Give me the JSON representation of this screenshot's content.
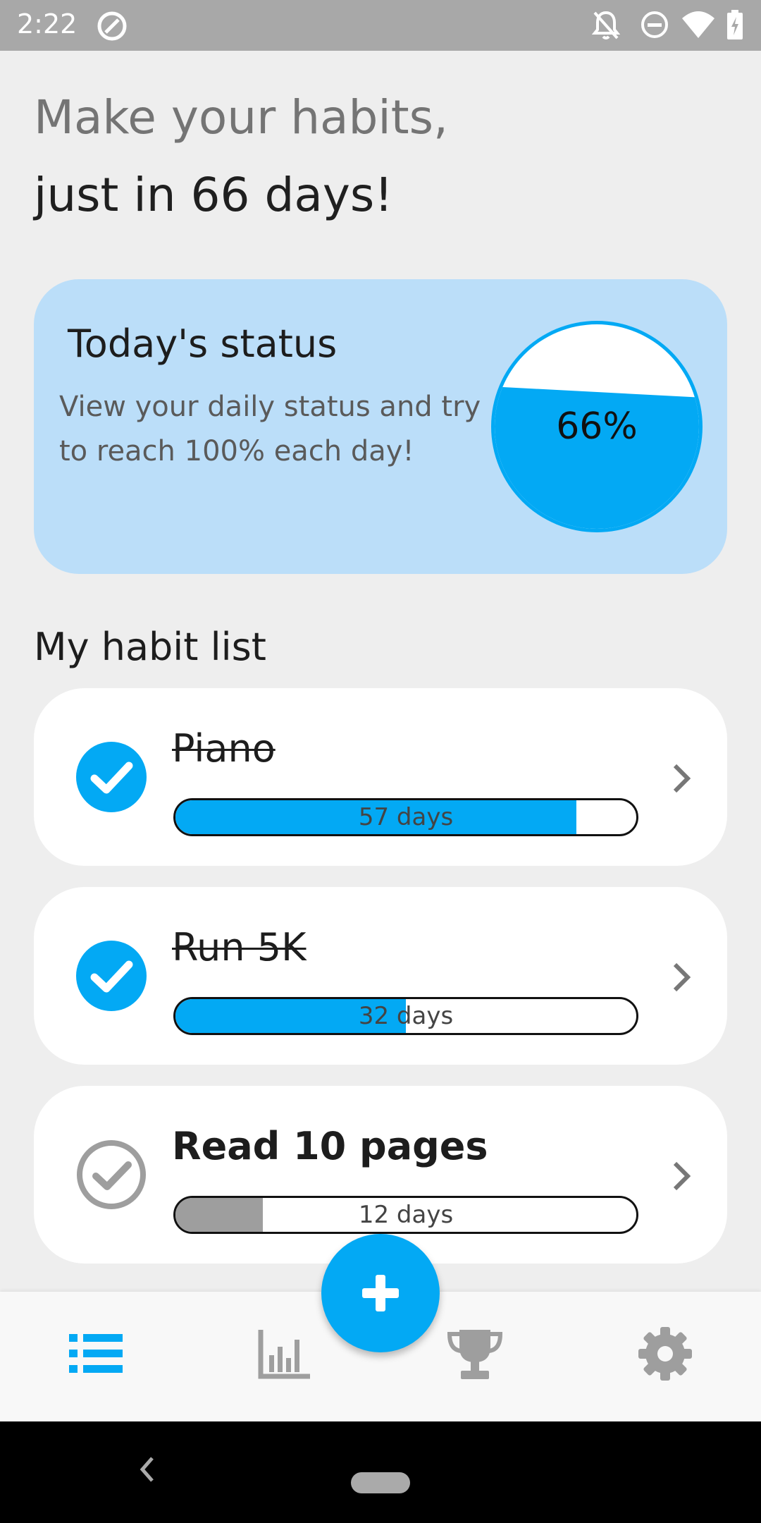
{
  "status_bar": {
    "time": "2:22",
    "icons": [
      "at-sign-icon",
      "notifications-off-icon",
      "do-not-disturb-icon",
      "wifi-icon",
      "battery-charging-icon"
    ]
  },
  "header": {
    "line1": "Make your habits,",
    "line2": "just in 66 days!"
  },
  "status_card": {
    "title": "Today's status",
    "description": "View your daily status and try to reach 100% each day!",
    "percent_label": "66%",
    "percent_value": 66
  },
  "habit_list": {
    "title": "My habit list",
    "items": [
      {
        "name": "Piano",
        "completed": true,
        "days_label": "57 days",
        "progress": 0.87,
        "fill_color": "#03a9f4"
      },
      {
        "name": "Run 5K",
        "completed": true,
        "days_label": "32 days",
        "progress": 0.5,
        "fill_color": "#03a9f4"
      },
      {
        "name": "Read 10 pages",
        "completed": false,
        "days_label": "12 days",
        "progress": 0.19,
        "fill_color": "#9e9e9e"
      }
    ]
  },
  "fab": {
    "icon": "plus-icon"
  },
  "bottom_nav": {
    "items": [
      {
        "icon": "list-icon",
        "active": true
      },
      {
        "icon": "bar-chart-icon",
        "active": false
      },
      {
        "icon": "trophy-icon",
        "active": false
      },
      {
        "icon": "settings-gear-icon",
        "active": false
      }
    ]
  },
  "colors": {
    "accent": "#03a9f4",
    "card_bg": "#bbdef9",
    "inactive_icon": "#9e9e9e",
    "background": "#eeeeee"
  }
}
